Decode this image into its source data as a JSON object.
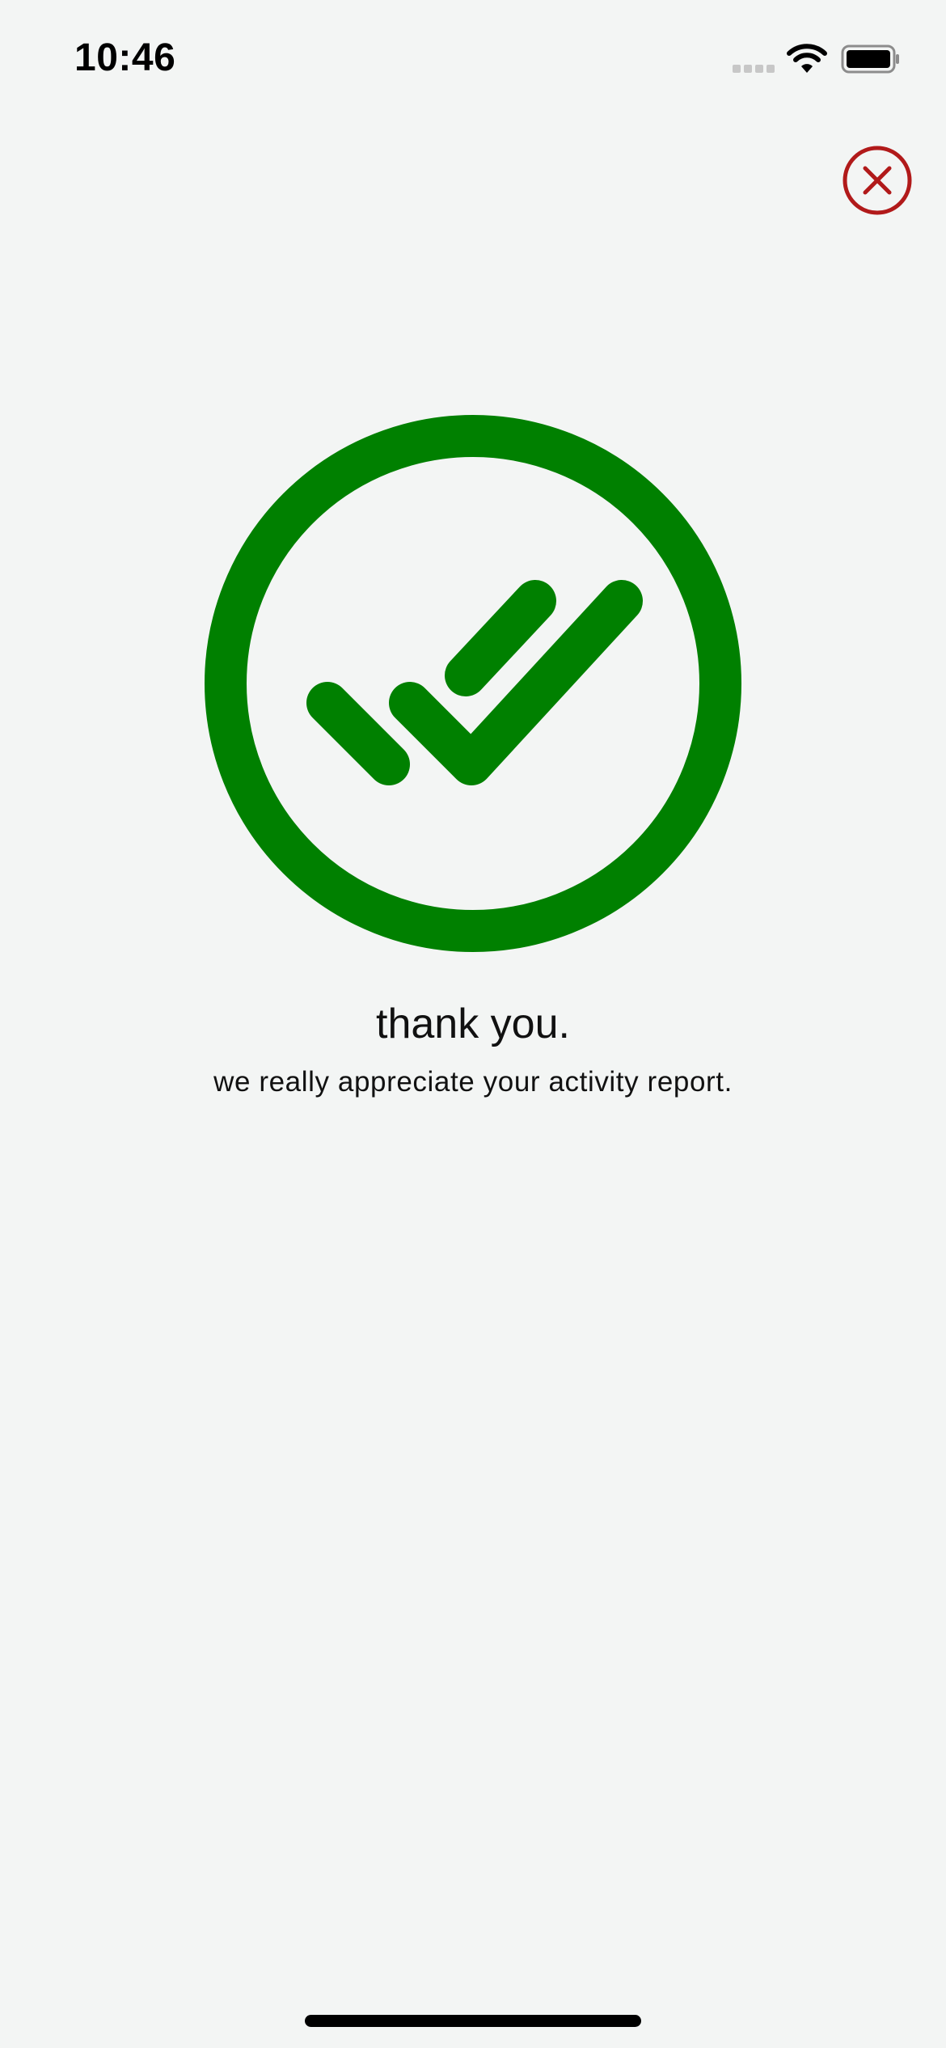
{
  "status_bar": {
    "time": "10:46",
    "icons": [
      "signal-dots-icon",
      "wifi-icon",
      "battery-icon"
    ]
  },
  "header": {
    "close_icon": "close-circle-icon",
    "close_color": "#b11a1a"
  },
  "graphic": {
    "icon": "double-check-circle-icon",
    "color": "#008000"
  },
  "message": {
    "title": "thank you.",
    "subtitle": "we really appreciate your activity report."
  }
}
